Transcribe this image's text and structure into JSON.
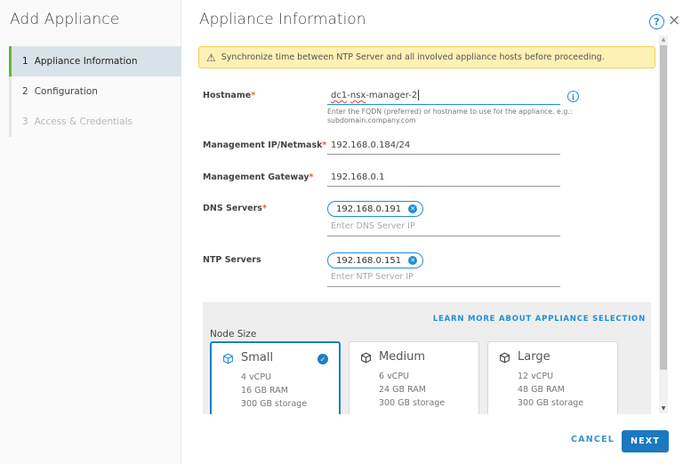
{
  "sidebar": {
    "title": "Add Appliance",
    "steps": [
      {
        "num": "1",
        "label": "Appliance Information",
        "state": "active"
      },
      {
        "num": "2",
        "label": "Configuration",
        "state": "enabled"
      },
      {
        "num": "3",
        "label": "Access & Credentials",
        "state": "disabled"
      }
    ]
  },
  "header": {
    "title": "Appliance Information",
    "help_icon": "?",
    "close_icon": "×"
  },
  "alert": {
    "icon": "⚠",
    "text": "Synchronize time between NTP Server and all involved appliance hosts before proceeding."
  },
  "form": {
    "hostname": {
      "label": "Hostname",
      "required": "*",
      "value_prefix": "dc1-",
      "value_misspelled": "nsx",
      "value_suffix": "-manager-2",
      "value_first": "dc1",
      "helper": "Enter the FQDN (preferred) or hostname to use for the appliance. e.g.: subdomain.company.com",
      "info_icon": "i"
    },
    "mgmt_ip": {
      "label": "Management IP/Netmask",
      "required": "*",
      "value": "192.168.0.184/24"
    },
    "mgmt_gateway": {
      "label": "Management Gateway",
      "required": "*",
      "value": "192.168.0.1"
    },
    "dns": {
      "label": "DNS Servers",
      "required": "*",
      "chips": [
        "192.168.0.191"
      ],
      "placeholder": "Enter DNS Server IP"
    },
    "ntp": {
      "label": "NTP Servers",
      "chips": [
        "192.168.0.151"
      ],
      "placeholder": "Enter NTP Server IP"
    }
  },
  "node_size": {
    "learn_more": "LEARN MORE ABOUT APPLIANCE SELECTION",
    "label": "Node Size",
    "selected": "Small",
    "options": [
      {
        "name": "Small",
        "cpu": "4 vCPU",
        "ram": "16 GB RAM",
        "storage": "300 GB storage"
      },
      {
        "name": "Medium",
        "cpu": "6 vCPU",
        "ram": "24 GB RAM",
        "storage": "300 GB storage"
      },
      {
        "name": "Large",
        "cpu": "12 vCPU",
        "ram": "48 GB RAM",
        "storage": "300 GB storage"
      }
    ]
  },
  "footer": {
    "cancel_label": "CANCEL",
    "next_label": "NEXT"
  },
  "colors": {
    "accent": "#1f8fd6",
    "primary_button": "#1c78c0",
    "active_step_bar": "#5fb832",
    "required": "#e35d3c",
    "alert_bg": "#fdf1b6"
  }
}
